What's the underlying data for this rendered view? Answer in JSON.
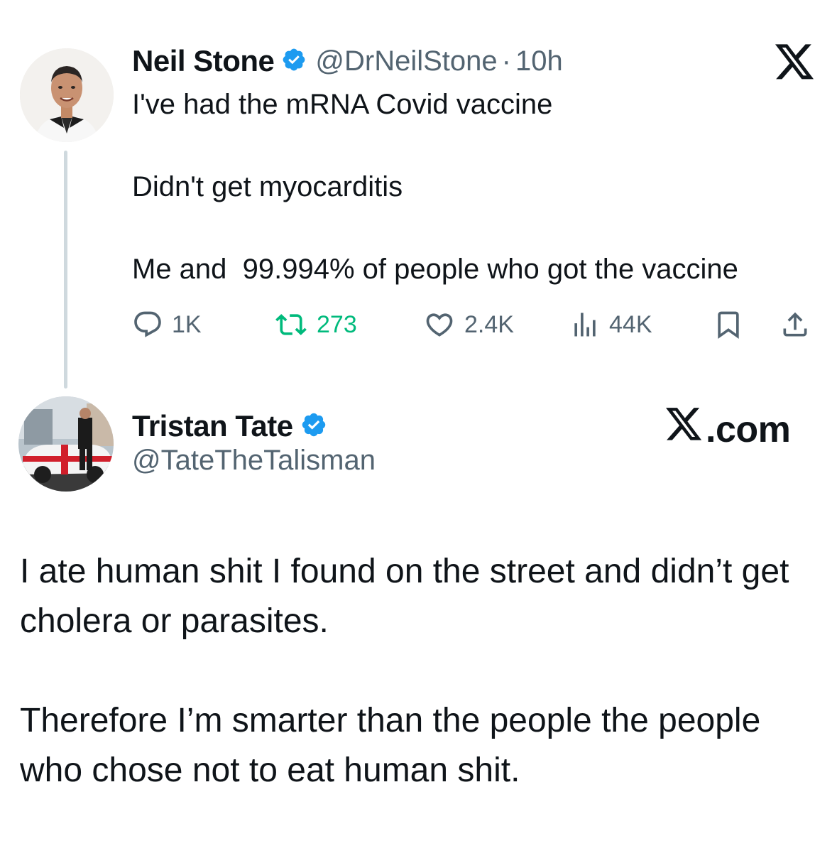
{
  "tweet": {
    "author": {
      "name": "Neil Stone",
      "handle": "@DrNeilStone",
      "separator": "·",
      "time": "10h",
      "avatar": "portrait-avatar"
    },
    "text": "I've had the mRNA Covid vaccine\n\nDidn't get myocarditis\n\nMe and  99.994% of people who got the vaccine",
    "actions": {
      "reply_count": "1K",
      "retweet_count": "273",
      "like_count": "2.4K",
      "view_count": "44K"
    },
    "icons": [
      "x-logo-icon",
      "verified-badge-icon",
      "reply-icon",
      "retweet-icon",
      "like-icon",
      "views-icon",
      "bookmark-icon",
      "share-icon"
    ]
  },
  "reply": {
    "author": {
      "name": "Tristan Tate",
      "handle": "@TateTheTalisman",
      "avatar": "car-photo-avatar"
    },
    "brand": {
      "suffix": ".com"
    },
    "text": "I ate human shit I found on the street and didn’t get cholera or parasites.\n\nTherefore I’m smarter than the people the people who chose not to eat human shit."
  },
  "colors": {
    "verified": "#1d9bf0",
    "secondary_text": "#536471",
    "retweet_active": "#00ba7c",
    "thread_line": "#cfd9de",
    "text": "#0f1419"
  }
}
